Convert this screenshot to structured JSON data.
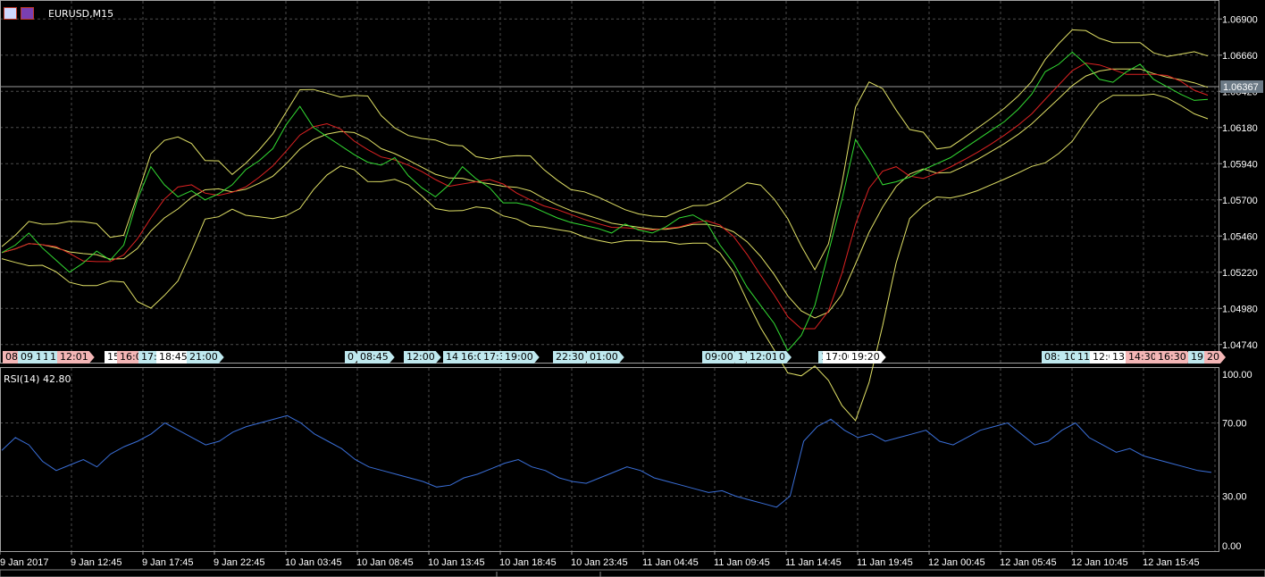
{
  "header": {
    "symbol": "EURUSD,M15"
  },
  "price_axis": {
    "labels": [
      "1.06900",
      "1.06660",
      "1.06420",
      "1.06180",
      "1.05940",
      "1.05700",
      "1.05460",
      "1.05220",
      "1.04980",
      "1.04740"
    ],
    "current_price": "1.06367"
  },
  "rsi": {
    "label": "RSI(14) 42.80",
    "axis_labels": [
      "100.00",
      "70.00",
      "30.00",
      "0.00"
    ]
  },
  "time_axis": [
    "9 Jan 2017",
    "9 Jan 12:45",
    "9 Jan 17:45",
    "9 Jan 22:45",
    "10 Jan 03:45",
    "10 Jan 08:45",
    "10 Jan 13:45",
    "10 Jan 18:45",
    "10 Jan 23:45",
    "11 Jan 04:45",
    "11 Jan 09:45",
    "11 Jan 14:45",
    "11 Jan 19:45",
    "12 Jan 00:45",
    "12 Jan 05:45",
    "12 Jan 10:45",
    "12 Jan 15:45"
  ],
  "event_tags": [
    {
      "text": "08",
      "color": "#f4b6b6"
    },
    {
      "text": "09",
      "color": "#bfe9ef"
    },
    {
      "text": "1",
      "color": "#bfe9ef"
    },
    {
      "text": "11",
      "color": "#bfe9ef"
    },
    {
      "text": "1",
      "color": "#bfe9ef"
    },
    {
      "text": "12:01",
      "color": "#f4b6b6"
    },
    {
      "text": "15",
      "color": "#ffffff"
    },
    {
      "text": "16:0",
      "color": "#f4b6b6"
    },
    {
      "text": "17:",
      "color": "#bfe9ef"
    },
    {
      "text": "18:45",
      "color": "#ffffff"
    },
    {
      "text": "21:00",
      "color": "#bfe9ef"
    },
    {
      "text": "0",
      "color": "#bfe9ef"
    },
    {
      "text": "08:45",
      "color": "#bfe9ef"
    },
    {
      "text": "12:00",
      "color": "#bfe9ef"
    },
    {
      "text": "14:",
      "color": "#bfe9ef"
    },
    {
      "text": "16:0",
      "color": "#bfe9ef"
    },
    {
      "text": "17:3",
      "color": "#bfe9ef"
    },
    {
      "text": "19:00",
      "color": "#bfe9ef"
    },
    {
      "text": "22:30",
      "color": "#bfe9ef"
    },
    {
      "text": "01:00",
      "color": "#bfe9ef"
    },
    {
      "text": "09:00",
      "color": "#bfe9ef"
    },
    {
      "text": "1",
      "color": "#bfe9ef"
    },
    {
      "text": "12:01",
      "color": "#bfe9ef"
    },
    {
      "text": "0",
      "color": "#bfe9ef"
    },
    {
      "text": "1",
      "color": "#bfe9ef"
    },
    {
      "text": "17:00",
      "color": "#ffffff"
    },
    {
      "text": "19:20",
      "color": "#ffffff"
    },
    {
      "text": "08:",
      "color": "#bfe9ef"
    },
    {
      "text": "10",
      "color": "#bfe9ef"
    },
    {
      "text": "11",
      "color": "#bfe9ef"
    },
    {
      "text": "12:0",
      "color": "#ffffff"
    },
    {
      "text": "13",
      "color": "#ffffff"
    },
    {
      "text": "14:30",
      "color": "#f4b6b6"
    },
    {
      "text": "16:30",
      "color": "#f4b6b6"
    },
    {
      "text": "19:",
      "color": "#bfe9ef"
    },
    {
      "text": "20",
      "color": "#f4b6b6"
    }
  ],
  "colors": {
    "background": "#000000",
    "grid": "#4d4d4d",
    "price_line": "#33dd33",
    "moving_average": "#dd2222",
    "bands": "#e0e066",
    "rsi_line": "#3a6fd8"
  },
  "chart_data": {
    "type": "line",
    "price_ylim": [
      1.0462,
      1.0702
    ],
    "rsi_ylim": [
      0,
      100
    ],
    "price_series_sample": [
      1.0535,
      1.054,
      1.0548,
      1.0538,
      1.053,
      1.0522,
      1.0528,
      1.0536,
      1.053,
      1.054,
      1.057,
      1.0592,
      1.058,
      1.0572,
      1.0576,
      1.057,
      1.0574,
      1.058,
      1.059,
      1.0596,
      1.0604,
      1.062,
      1.0632,
      1.0618,
      1.0612,
      1.0606,
      1.06,
      1.0595,
      1.0593,
      1.0598,
      1.0586,
      1.0578,
      1.0572,
      1.058,
      1.0592,
      1.0584,
      1.0578,
      1.0568,
      1.0568,
      1.0566,
      1.0562,
      1.0558,
      1.0555,
      1.0553,
      1.0551,
      1.0548,
      1.0554,
      1.055,
      1.0548,
      1.0552,
      1.0558,
      1.056,
      1.0555,
      1.054,
      1.0528,
      1.0512,
      1.05,
      1.0488,
      1.047,
      1.048,
      1.05,
      1.0535,
      1.057,
      1.061,
      1.0596,
      1.058,
      1.0582,
      1.0585,
      1.059,
      1.0594,
      1.0598,
      1.0604,
      1.061,
      1.0616,
      1.0622,
      1.063,
      1.064,
      1.0655,
      1.066,
      1.0668,
      1.066,
      1.065,
      1.0648,
      1.0655,
      1.066,
      1.065,
      1.0645,
      1.064,
      1.0636,
      1.06367
    ],
    "rsi_series_sample": [
      55,
      62,
      58,
      49,
      44,
      47,
      50,
      46,
      53,
      57,
      60,
      64,
      70,
      66,
      62,
      58,
      60,
      65,
      68,
      70,
      72,
      74,
      70,
      64,
      60,
      56,
      50,
      46,
      44,
      42,
      40,
      38,
      35,
      36,
      40,
      42,
      45,
      48,
      50,
      46,
      44,
      40,
      38,
      37,
      40,
      43,
      46,
      44,
      40,
      38,
      36,
      34,
      32,
      33,
      30,
      28,
      26,
      24,
      30,
      60,
      68,
      72,
      66,
      62,
      64,
      60,
      62,
      64,
      66,
      60,
      58,
      62,
      66,
      68,
      70,
      64,
      58,
      60,
      66,
      70,
      62,
      58,
      54,
      56,
      52,
      50,
      48,
      46,
      44,
      43
    ]
  }
}
